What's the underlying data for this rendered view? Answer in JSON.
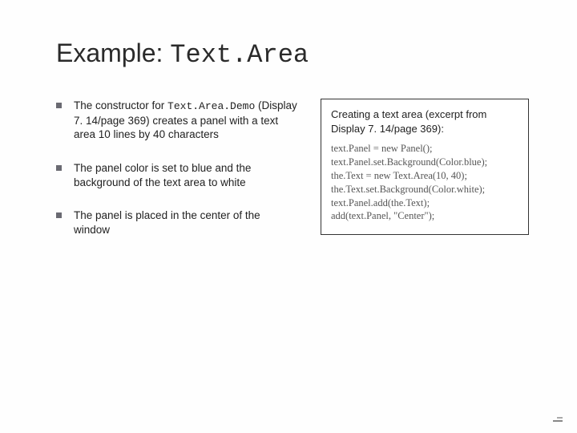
{
  "title": {
    "pre": "Example: ",
    "code": "Text.Area"
  },
  "bullets": [
    {
      "t1": "The constructor for ",
      "code": "Text.Area.Demo",
      "t2": " (Display 7. 14/page 369) creates a panel with a text area 10 lines by 40 characters"
    },
    {
      "t1": "The panel color is set to blue and the background of the text area to white",
      "code": "",
      "t2": ""
    },
    {
      "t1": "The panel is placed in the center of the window",
      "code": "",
      "t2": ""
    }
  ],
  "codebox": {
    "caption": "Creating a text area (excerpt from Display 7. 14/page 369):",
    "lines": [
      "text.Panel = new Panel();",
      "text.Panel.set.Background(Color.blue);",
      "the.Text = new Text.Area(10, 40);",
      "the.Text.set.Background(Color.white);",
      "text.Panel.add(the.Text);",
      "add(text.Panel, \"Center\");"
    ]
  }
}
